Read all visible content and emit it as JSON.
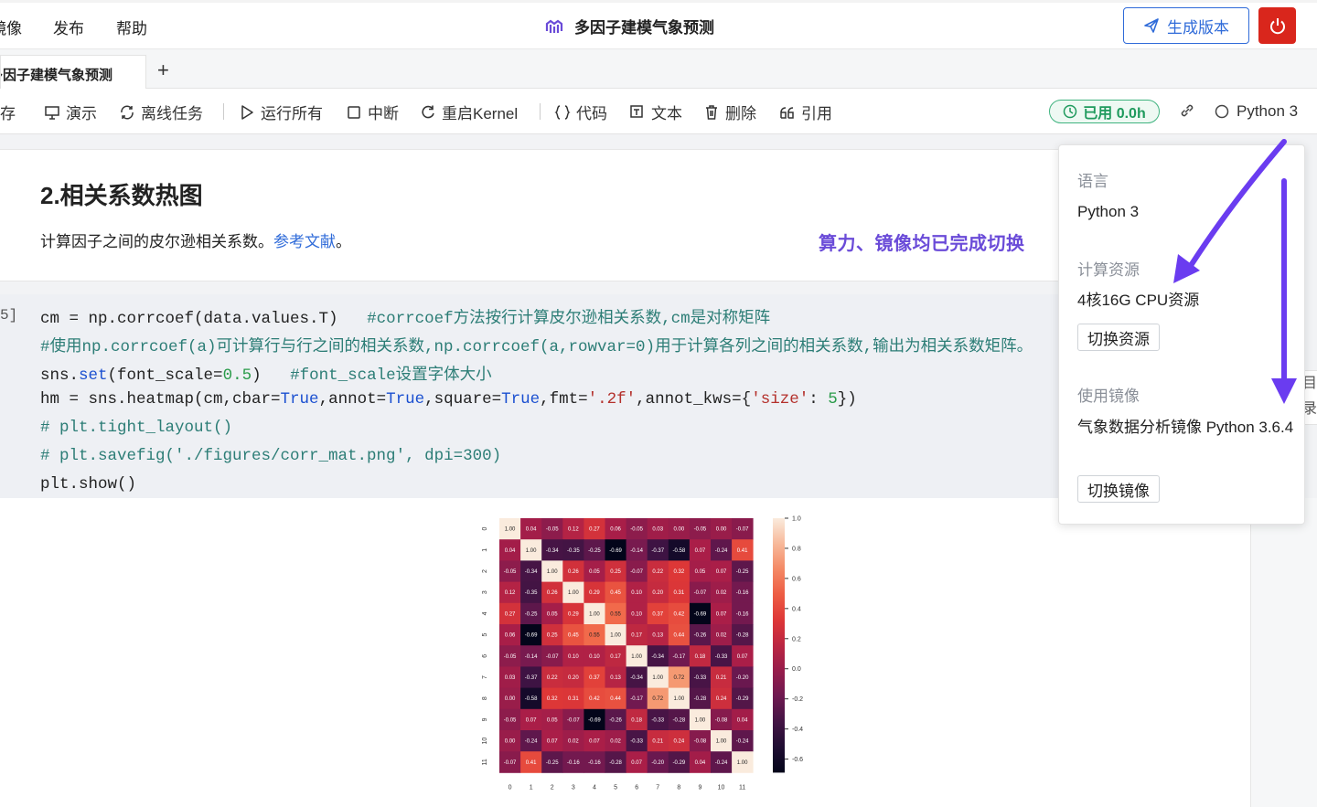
{
  "topbar": {
    "menus": [
      "镜像",
      "发布",
      "帮助"
    ],
    "title": "多因子建模气象预测",
    "generate_label": "生成版本"
  },
  "tabs": {
    "active_label": "多因子建模气象预测",
    "add_label": "+"
  },
  "toolbar": {
    "items": [
      "保存",
      "演示",
      "离线任务",
      "运行所有",
      "中断",
      "重启Kernel",
      "代码",
      "文本",
      "删除",
      "引用"
    ],
    "usage": "已用 0.0h",
    "kernel": "Python 3"
  },
  "markdown_cell": {
    "title": "2.相关系数热图",
    "text": "计算因子之间的皮尔逊相关系数。",
    "link": "参考文献",
    "end": "。"
  },
  "note": "算力、镜像均已完成切换",
  "code_cell": {
    "prompt": "5]",
    "line1_code": "cm = np.corrcoef(data.values.T)   ",
    "line1_comment": "#corrcoef方法按行计算皮尔逊相关系数,cm是对称矩阵",
    "line2_comment": "#使用np.corrcoef(a)可计算行与行之间的相关系数,np.corrcoef(a,rowvar=0)用于计算各列之间的相关系数,输出为相关系数矩阵。",
    "line3_a": "sns.",
    "line3_kw": "set",
    "line3_b": "(font_scale=",
    "line3_num": "0.5",
    "line3_c": ")   ",
    "line3_comment": "#font_scale设置字体大小",
    "line4_a": "hm = sns.heatmap(cm,cbar=",
    "line4_t1": "True",
    "line4_b": ",annot=",
    "line4_t2": "True",
    "line4_c": ",square=",
    "line4_t3": "True",
    "line4_d": ",fmt=",
    "line4_s1": "'.2f'",
    "line4_e": ",annot_kws={",
    "line4_s2": "'size'",
    "line4_f": ": ",
    "line4_num": "5",
    "line4_g": "})",
    "line5_comment": "# plt.tight_layout()",
    "line6_comment": "# plt.savefig('./figures/corr_mat.png', dpi=300)",
    "line7": "plt.show()"
  },
  "popup": {
    "language_label": "语言",
    "language_value": "Python 3",
    "resource_label": "计算资源",
    "resource_value": "4核16G CPU资源",
    "resource_button": "切换资源",
    "image_label": "使用镜像",
    "image_value": "气象数据分析镜像 Python 3.6.4",
    "image_button": "切换镜像"
  },
  "side_tab_text": "目录",
  "colors": {
    "accent": "#2f6bd9",
    "danger": "#d9261c",
    "success": "#1f9a5d",
    "annotation": "#6a4bd8"
  },
  "chart_data": {
    "type": "heatmap",
    "categories": [
      "0",
      "1",
      "2",
      "3",
      "4",
      "5",
      "6",
      "7",
      "8",
      "9",
      "10",
      "11"
    ],
    "values": [
      [
        1.0,
        0.04,
        -0.05,
        0.12,
        0.27,
        0.06,
        -0.05,
        0.03,
        -0.0,
        -0.05,
        -0.0,
        -0.07
      ],
      [
        0.04,
        1.0,
        -0.34,
        -0.35,
        -0.25,
        -0.69,
        -0.14,
        -0.37,
        -0.58,
        0.07,
        -0.24,
        0.41
      ],
      [
        -0.05,
        -0.34,
        1.0,
        0.26,
        0.05,
        0.25,
        -0.07,
        0.22,
        0.32,
        0.05,
        0.07,
        -0.25
      ],
      [
        0.12,
        -0.35,
        0.26,
        1.0,
        0.29,
        0.45,
        0.1,
        0.2,
        0.31,
        -0.07,
        0.02,
        -0.16
      ],
      [
        0.27,
        -0.25,
        0.05,
        0.29,
        1.0,
        0.55,
        0.1,
        0.37,
        0.42,
        -0.69,
        0.07,
        -0.16
      ],
      [
        0.06,
        -0.69,
        0.25,
        0.45,
        0.55,
        1.0,
        0.17,
        0.13,
        0.44,
        -0.26,
        0.02,
        -0.28
      ],
      [
        -0.05,
        -0.14,
        -0.07,
        0.1,
        0.1,
        0.17,
        1.0,
        -0.34,
        -0.17,
        0.18,
        -0.33,
        0.07
      ],
      [
        0.03,
        -0.37,
        0.22,
        0.2,
        0.37,
        0.13,
        -0.34,
        1.0,
        0.72,
        -0.33,
        0.21,
        -0.2
      ],
      [
        -0.0,
        -0.58,
        0.32,
        0.31,
        0.42,
        0.44,
        -0.17,
        0.72,
        1.0,
        -0.28,
        0.24,
        -0.29
      ],
      [
        -0.05,
        0.07,
        0.05,
        -0.07,
        -0.69,
        -0.26,
        0.18,
        -0.33,
        -0.28,
        1.0,
        -0.08,
        0.04
      ],
      [
        -0.0,
        -0.24,
        0.07,
        0.02,
        0.07,
        0.02,
        -0.33,
        0.21,
        0.24,
        -0.08,
        1.0,
        -0.24
      ],
      [
        -0.07,
        0.41,
        -0.25,
        -0.16,
        -0.16,
        -0.28,
        0.07,
        -0.2,
        -0.29,
        0.04,
        -0.24,
        1.0
      ]
    ],
    "colorbar_ticks": [
      "1.0",
      "0.8",
      "0.6",
      "0.4",
      "0.2",
      "0.0",
      "-0.2",
      "-0.4",
      "-0.6"
    ],
    "vmin": -0.69,
    "vmax": 1.0
  }
}
